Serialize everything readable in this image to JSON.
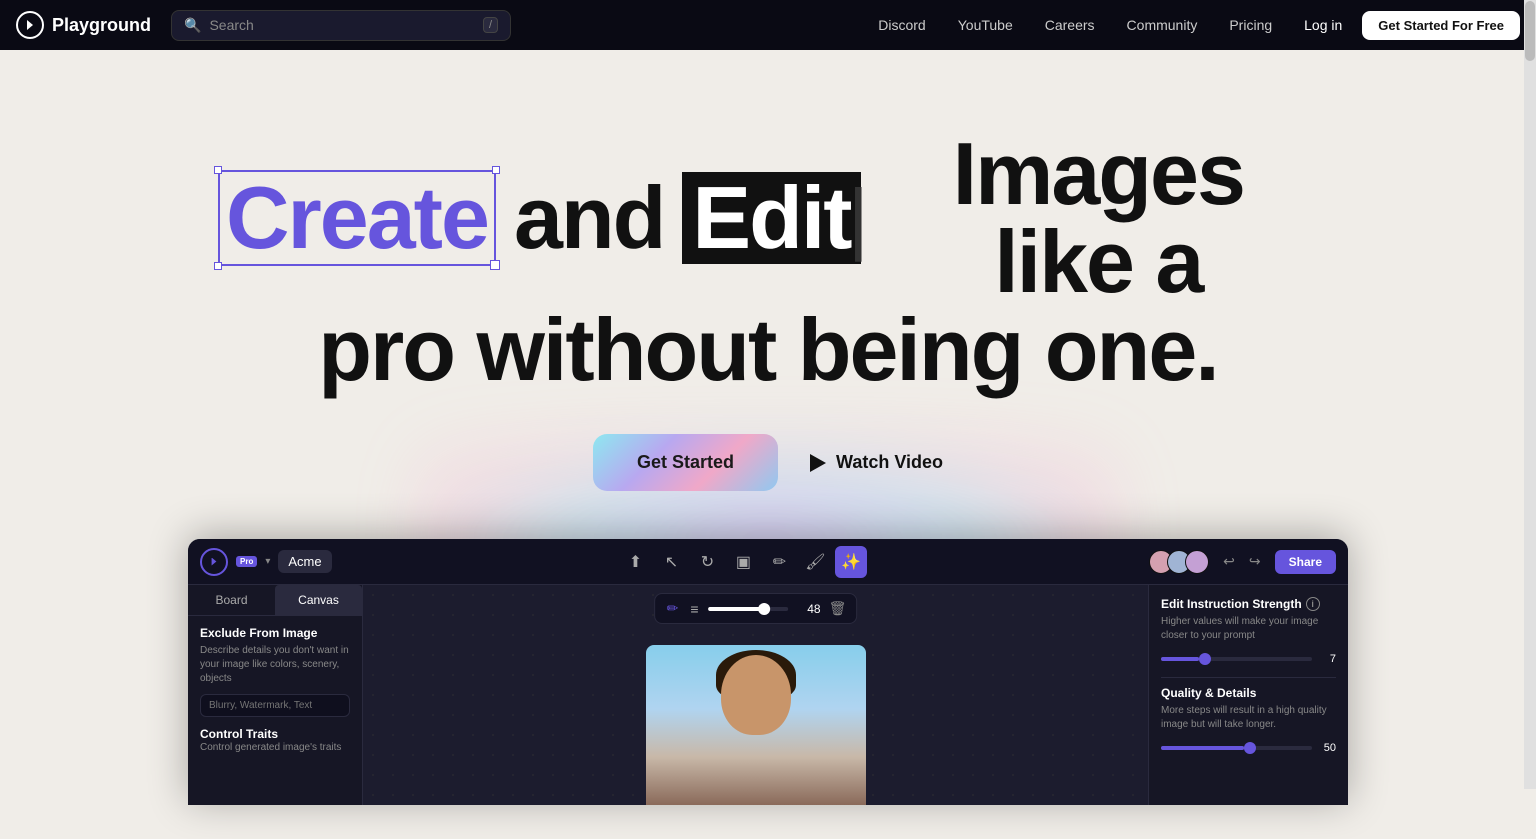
{
  "navbar": {
    "logo_text": "Playground",
    "search_placeholder": "Search",
    "search_shortcut": "/",
    "links": [
      {
        "label": "Discord",
        "id": "discord"
      },
      {
        "label": "YouTube",
        "id": "youtube"
      },
      {
        "label": "Careers",
        "id": "careers"
      },
      {
        "label": "Community",
        "id": "community"
      },
      {
        "label": "Pricing",
        "id": "pricing"
      }
    ],
    "login_label": "Log in",
    "cta_label": "Get Started For Free"
  },
  "hero": {
    "word_create": "Create",
    "word_and": "and",
    "word_edit": "Edit",
    "rest_line1": "Images like a",
    "line2": "pro without being one.",
    "btn_get_started": "Get Started",
    "btn_watch_video": "Watch Video"
  },
  "app_preview": {
    "badge": "Pro",
    "project_name": "Acme",
    "share_btn": "Share",
    "tabs": [
      {
        "label": "Board"
      },
      {
        "label": "Canvas"
      }
    ],
    "left_panel": {
      "exclude_title": "Exclude From Image",
      "exclude_desc": "Describe details you don't want in your image like colors, scenery, objects",
      "exclude_placeholder": "Blurry, Watermark, Text",
      "control_title": "Control Traits",
      "control_desc": "Control generated image's traits"
    },
    "canvas": {
      "slider_value": "48",
      "delete_icon": "🗑"
    },
    "right_panel": {
      "strength_title": "Edit Instruction Strength",
      "strength_desc": "Higher values will make your image closer to your prompt",
      "strength_value": "7",
      "strength_fill_pct": "25",
      "quality_title": "Quality & Details",
      "quality_desc": "More steps will result in a high quality image but will take longer.",
      "quality_value": "50",
      "quality_fill_pct": "55"
    }
  }
}
